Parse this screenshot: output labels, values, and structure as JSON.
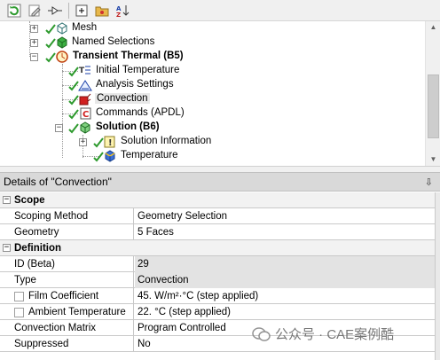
{
  "toolbar": {
    "buttons": [
      "refresh-icon",
      "edit-icon",
      "filter-icon",
      "expand-all-icon",
      "folder-icon",
      "sort-icon"
    ]
  },
  "tree": {
    "items": [
      {
        "label": "Mesh",
        "bold": false
      },
      {
        "label": "Named Selections",
        "bold": false
      },
      {
        "label": "Transient Thermal (B5)",
        "bold": true
      },
      {
        "label": "Initial Temperature",
        "bold": false
      },
      {
        "label": "Analysis Settings",
        "bold": false
      },
      {
        "label": "Convection",
        "bold": false,
        "selected": true
      },
      {
        "label": "Commands (APDL)",
        "bold": false
      },
      {
        "label": "Solution (B6)",
        "bold": true
      },
      {
        "label": "Solution Information",
        "bold": false
      },
      {
        "label": "Temperature",
        "bold": false
      }
    ]
  },
  "details": {
    "title": "Details of \"Convection\"",
    "pin": "⇩",
    "groups": {
      "scope": "Scope",
      "definition": "Definition"
    },
    "rows": {
      "scoping_method": {
        "label": "Scoping Method",
        "value": "Geometry Selection"
      },
      "geometry": {
        "label": "Geometry",
        "value": "5 Faces"
      },
      "id": {
        "label": "ID (Beta)",
        "value": "29"
      },
      "type": {
        "label": "Type",
        "value": "Convection"
      },
      "film": {
        "label": "Film Coefficient",
        "value": "45. W/m²·°C  (step applied)"
      },
      "ambient": {
        "label": "Ambient Temperature",
        "value": "22. °C  (step applied)"
      },
      "matrix": {
        "label": "Convection Matrix",
        "value": "Program Controlled"
      },
      "suppressed": {
        "label": "Suppressed",
        "value": "No"
      }
    }
  },
  "watermark": {
    "text": "公众号 · CAE案例酷"
  }
}
